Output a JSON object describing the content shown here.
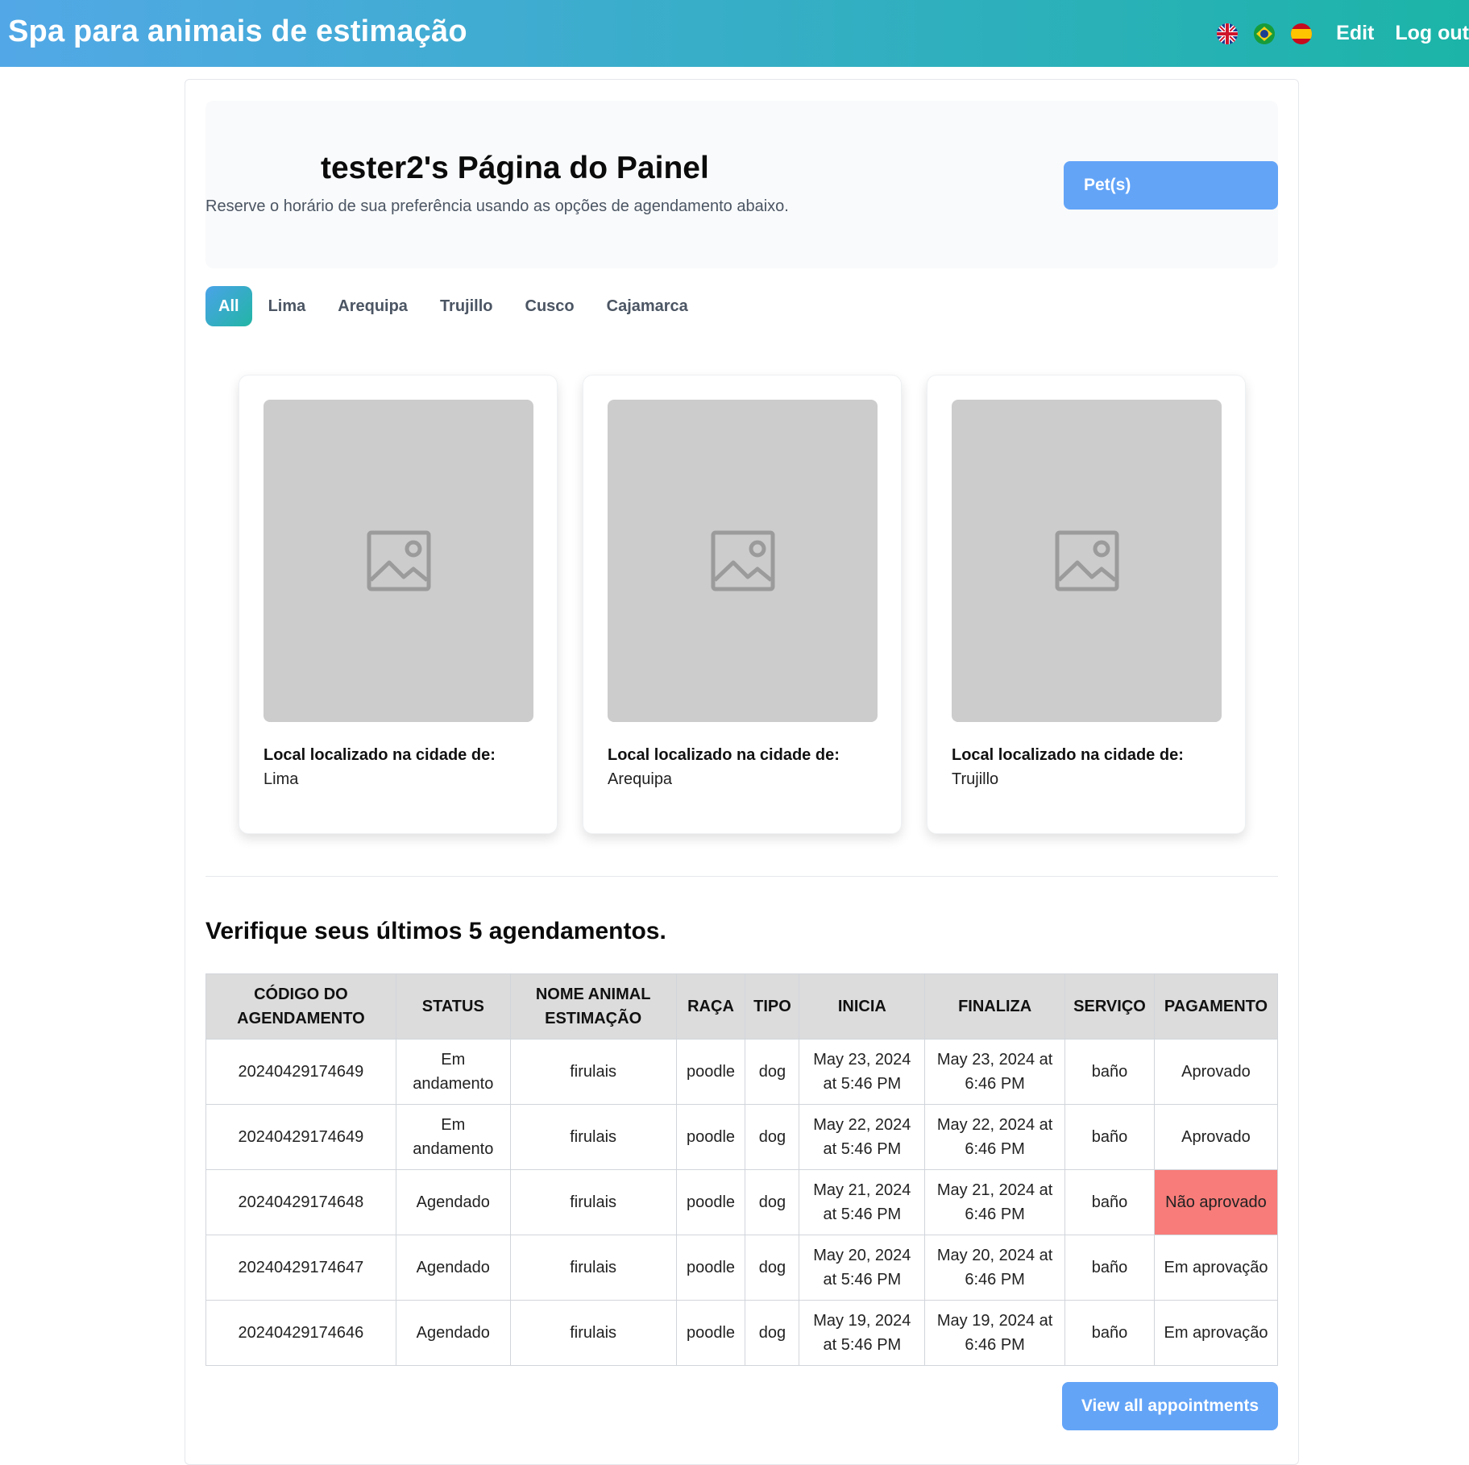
{
  "header": {
    "brand": "Spa para animais de estimação",
    "flags": [
      "uk-flag",
      "brazil-flag",
      "spain-flag"
    ],
    "edit_label": "Edit",
    "logout_label": "Log out",
    "gradient_start": "#52a8e6",
    "gradient_end": "#1cb4a8"
  },
  "hero": {
    "title": "tester2's Página do Painel",
    "subtitle": "Reserve o horário de sua preferência usando as opções de agendamento abaixo.",
    "pets_button": "Pet(s)"
  },
  "tabs": [
    {
      "label": "All",
      "active": true
    },
    {
      "label": "Lima",
      "active": false
    },
    {
      "label": "Arequipa",
      "active": false
    },
    {
      "label": "Trujillo",
      "active": false
    },
    {
      "label": "Cusco",
      "active": false
    },
    {
      "label": "Cajamarca",
      "active": false
    }
  ],
  "cards": [
    {
      "label": "Local localizado na cidade de:",
      "city": "Lima",
      "image_icon": "image-placeholder-icon"
    },
    {
      "label": "Local localizado na cidade de:",
      "city": "Arequipa",
      "image_icon": "image-placeholder-icon"
    },
    {
      "label": "Local localizado na cidade de:",
      "city": "Trujillo",
      "image_icon": "image-placeholder-icon"
    }
  ],
  "appointments": {
    "title": "Verifique seus últimos 5 agendamentos.",
    "columns": [
      "CÓDIGO DO AGENDAMENTO",
      "STATUS",
      "NOME ANIMAL ESTIMAÇÃO",
      "RAÇA",
      "TIPO",
      "INICIA",
      "FINALIZA",
      "SERVIÇO",
      "PAGAMENTO"
    ],
    "rows": [
      {
        "code": "20240429174649",
        "status": "Em andamento",
        "pet": "firulais",
        "breed": "poodle",
        "type": "dog",
        "start": "May 23, 2024 at 5:46 PM",
        "end": "May 23, 2024 at 6:46 PM",
        "service": "baño",
        "payment": "Aprovado",
        "rejected": false
      },
      {
        "code": "20240429174649",
        "status": "Em andamento",
        "pet": "firulais",
        "breed": "poodle",
        "type": "dog",
        "start": "May 22, 2024 at 5:46 PM",
        "end": "May 22, 2024 at 6:46 PM",
        "service": "baño",
        "payment": "Aprovado",
        "rejected": false
      },
      {
        "code": "20240429174648",
        "status": "Agendado",
        "pet": "firulais",
        "breed": "poodle",
        "type": "dog",
        "start": "May 21, 2024 at 5:46 PM",
        "end": "May 21, 2024 at 6:46 PM",
        "service": "baño",
        "payment": "Não aprovado",
        "rejected": true
      },
      {
        "code": "20240429174647",
        "status": "Agendado",
        "pet": "firulais",
        "breed": "poodle",
        "type": "dog",
        "start": "May 20, 2024 at 5:46 PM",
        "end": "May 20, 2024 at 6:46 PM",
        "service": "baño",
        "payment": "Em aprovação",
        "rejected": false
      },
      {
        "code": "20240429174646",
        "status": "Agendado",
        "pet": "firulais",
        "breed": "poodle",
        "type": "dog",
        "start": "May 19, 2024 at 5:46 PM",
        "end": "May 19, 2024 at 6:46 PM",
        "service": "baño",
        "payment": "Em aprovação",
        "rejected": false
      }
    ],
    "rejected_color": "#f87c79",
    "view_all_label": "View all appointments"
  },
  "colors": {
    "button_blue": "#63a4f7",
    "hero_bg": "#f9fafb",
    "table_header_bg": "#dcdcdc",
    "placeholder_bg": "#cccccc"
  }
}
